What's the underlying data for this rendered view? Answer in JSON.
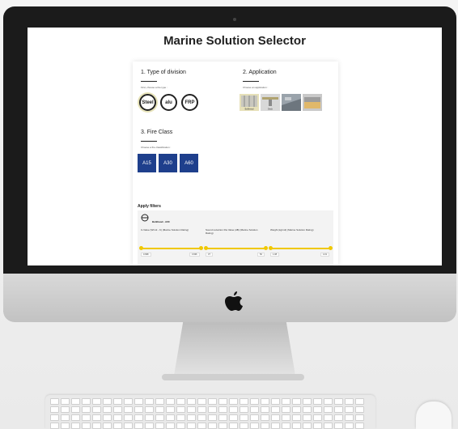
{
  "page_title": "Marine Solution Selector",
  "sections": {
    "division": {
      "title": "1. Type of division",
      "hint": "First, choose a the type :",
      "options": [
        "Steel",
        "alu",
        "FRP"
      ]
    },
    "application": {
      "title": "2. Application",
      "hint": "Choose an application :",
      "image_labels": [
        "Bulkhead",
        "Deck",
        "",
        ""
      ]
    },
    "fire": {
      "title": "3. Fire Class",
      "hint": "Choose a fire classification :",
      "options": [
        "A15",
        "A30",
        "A60"
      ]
    }
  },
  "filters": {
    "title": "Apply filters",
    "active": "Bulkhead - A60",
    "columns": [
      {
        "label": "U-Value (W/m2 - K) (Marine Solution Rating)",
        "min": "0.998",
        "max": "3.936"
      },
      {
        "label": "Sound reduction Rw Value (dB) (Marine Solution Rating)",
        "min": "37",
        "max": "50"
      },
      {
        "label": "Weight (kg/m2) (Marine Solution Rating)",
        "min": "1.08",
        "max": "4.01"
      }
    ]
  },
  "colors": {
    "fire_button": "#1e3f8c",
    "slider": "#f0c800"
  }
}
